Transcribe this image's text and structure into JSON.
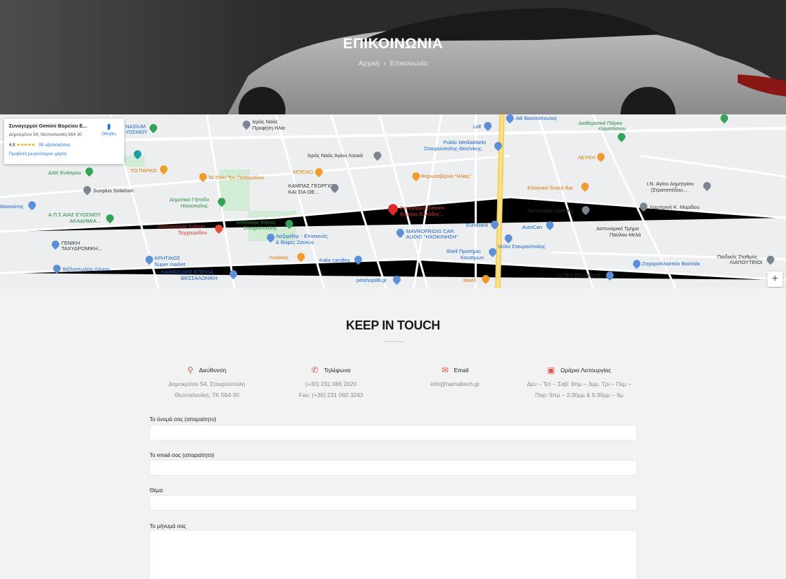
{
  "hero": {
    "title": "ΕΠΙΚΟΙΝΩΝΙΑ",
    "breadcrumb_home": "Αρχική",
    "breadcrumb_sep": "›",
    "breadcrumb_current": "Επικοινωνία"
  },
  "map": {
    "card": {
      "name": "Συναγερμοί Gemini Βορείου Ε...",
      "address": "Δημοκρίτου 54, Θεσσαλονίκη 564 30",
      "rating": "4,8",
      "stars": "★★★★★",
      "reviews": "95 αξιολογήσεις",
      "bigger_map": "Προβολή μεγαλύτερου χάρτη",
      "directions": "Οδηγίες"
    },
    "zoom_in": "+",
    "labels": {
      "gemini": "Συναγερμοί Gemini",
      "gemini2": "Βορείου Ελλάδος...",
      "public": "Public MediaMarkt",
      "public2": "Σταυρούπολης Θεσ/νίκης",
      "ab": "ΑΒ Βασιλόπουλος",
      "diat": "Διαθεματικό Πάρκο",
      "diat2": "Καρατάσιου",
      "lidl": "Lidl",
      "lefki": "ΛΕΥΚΗ",
      "ellhniko": "Ελληνικό Snack Bar",
      "ag_dim": "Ι.Ν. Αγίου Δημητρίου",
      "ag_dim2": "(Στρατοπέδου...",
      "lampr": "Λαμπρινή Κ. Μυρίδου",
      "samio": "Samiotakis Catering",
      "autocan": "AutoCan",
      "astyn": "Αστυνομικό Τμήμα",
      "astyn2": "Παύλου Μελά",
      "eurobank": "Eurobank",
      "mavrof": "MAVROFRIDIS CAR",
      "mavrof2": "AUDIO \"ΗΧΟΚΙΝΗΣΗ\"",
      "vicko": "Vicko Σταυρούπολης",
      "shell": "Shell Πρατήριο",
      "shell2": "Καυσίμων",
      "mikel": "Μικέλ",
      "geniko": "1ο ΓΕΛ ΠΟΛΙΧΝΗΣ",
      "zaxar": "Ζαχαροπλαστείο Βασιλάκ",
      "paidikos": "Παιδικός Σταθμός",
      "paidikos2": "ΛΙΑΠΟΥΤΕΙΟΙ",
      "ieros": "Ιερός Ναός",
      "ieros2": "Προφήτη Ηλία",
      "ieros_louka": "Ιερός Ναός Αγίου Λουκά",
      "moemo": "ΜΟΕΜΟ",
      "kampas": "ΚΑΜΠΑΣ ΓΕΩΡΓΙΟΣ",
      "kampas2": "ΚΑΙ ΣΙΑ ΟΕ...",
      "fara": "Φαρωταβέρνα \"Ηλίας\"",
      "steki": "Το Στέκι Του Παπαγάλου",
      "to_parko": "ΤΟ ΠΑΡΚΟ",
      "dak": "ΔΑΚ Ευόσμου",
      "sunplus": "Sunplus Solarium",
      "dimotiko": "Δημοτικό Γήπεδο",
      "dimotiko2": "Ηλιούπολης",
      "aps": "Α.Π.Σ ΑΙΑΣ ΕΥΟΣΜΟΥ",
      "aps2": "ΑΚΑΔΗΜΙΑ...",
      "odont": "Οδοντιατρείο Ιωάννα",
      "odont2": "Ταχχουρίδου",
      "votan": "Βοτανικός Κήπος",
      "votan2": "Σταυρούπολης",
      "lazar": "Λαζαρίδης - Επισκευές",
      "lazar2": "& Βαφές Ζαντών",
      "genikh": "ΓΕΝΙΚΗ",
      "genikh2": "ΤΑΧΥΔΡΟΜΙΚΗ...",
      "krit": "ΚΡΗΤΙΚΟΣ",
      "krit2": "Super market",
      "kaim": "ΚΑΙΜΑΣΙΔΗΣ ΕΠΙΠΛΑ",
      "kaim2": "ΘΕΣΣΑΛΟΝΙΚΗ",
      "kalia": "Kalia candles",
      "lykok": "Λυκόκος",
      "vivlio": "Βιβλιοπωλείο Λόγιον",
      "petshop": "petshop88.gr",
      "masoutis": "Μασούτης",
      "gymnasium": "ΝΑSIUM",
      "gymnasium2": "ΥΟΣΜΟΥ"
    }
  },
  "contact": {
    "heading": "KEEP IN TOUCH",
    "address": {
      "title": "Διεύθυνση",
      "line1": "Δημοκρίτου 54, Σταυρούπολη",
      "line2": "Θεσσαλονίκη, ΤΚ 564-30"
    },
    "phone": {
      "title": "Τηλέφωνα",
      "line1": "(+30) 231 086 2020",
      "line2": "Fax: (+30) 231 060 3243"
    },
    "email": {
      "title": "Email",
      "line1": "info@hamaltech.gr"
    },
    "hours": {
      "title": "Ωράριο Λειτουργίας",
      "line1": "Δευ – Τετ – Σαβ: 9πμ – 3μμ. Τρι – Πεμ –",
      "line2": "Παρ: 9πμ – 2:30μμ & 5:30μμ – 9μ"
    }
  },
  "form": {
    "name_label": "Το όνομά σας (απαραίτητο)",
    "email_label": "Το email σας (απαραίτητο)",
    "subject_label": "Θέμα",
    "message_label": "Το μήνυμά σας"
  }
}
